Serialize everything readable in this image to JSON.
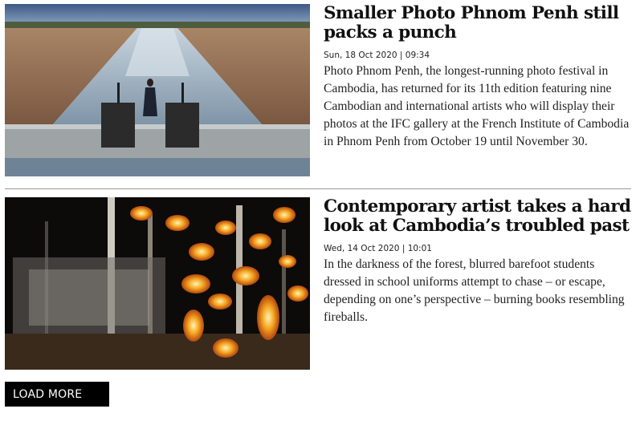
{
  "articles": [
    {
      "title": "Smaller Photo Phnom Penh still packs a punch",
      "date": "Sun, 18 Oct 2020 | 09:34",
      "summary": "Photo Phnom Penh, the longest-running photo festival in Cambodia, has returned for its 11th edition featuring nine Cambodian and international artists who will display their photos at the IFC gallery at the French Institute of Cambodia in Phnom Penh from October 19 until November 30."
    },
    {
      "title": "Contemporary artist takes a hard look at Cambodia’s troubled past",
      "date": "Wed, 14 Oct 2020 | 10:01",
      "summary": "In the darkness of the forest, blurred barefoot students dressed in school uniforms attempt to chase – or escape, depending on one’s perspective – burning books resembling fireballs."
    }
  ],
  "load_more_label": "LOAD MORE"
}
